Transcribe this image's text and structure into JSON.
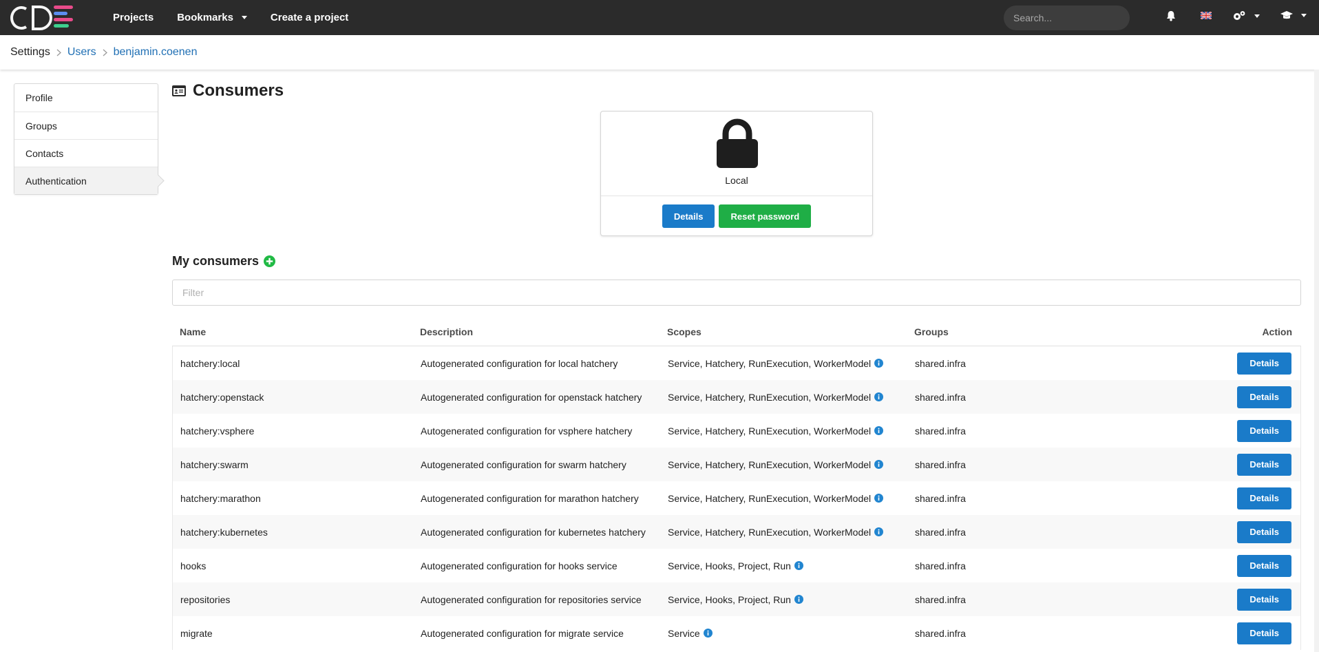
{
  "topbar": {
    "nav": [
      "Projects",
      "Bookmarks",
      "Create a project"
    ],
    "search_placeholder": "Search..."
  },
  "breadcrumb": [
    "Settings",
    "Users",
    "benjamin.coenen"
  ],
  "sidebar": {
    "items": [
      "Profile",
      "Groups",
      "Contacts",
      "Authentication"
    ],
    "active": "Authentication"
  },
  "page_title": "Consumers",
  "auth_card": {
    "label": "Local",
    "details_button": "Details",
    "reset_button": "Reset password"
  },
  "consumers": {
    "title": "My consumers",
    "filter_placeholder": "Filter",
    "columns": [
      "Name",
      "Description",
      "Scopes",
      "Groups",
      "Action"
    ],
    "rows": [
      {
        "name": "hatchery:local",
        "description": "Autogenerated configuration for local hatchery",
        "scopes": "Service, Hatchery, RunExecution, WorkerModel",
        "groups": "shared.infra",
        "action": "Details"
      },
      {
        "name": "hatchery:openstack",
        "description": "Autogenerated configuration for openstack hatchery",
        "scopes": "Service, Hatchery, RunExecution, WorkerModel",
        "groups": "shared.infra",
        "action": "Details"
      },
      {
        "name": "hatchery:vsphere",
        "description": "Autogenerated configuration for vsphere hatchery",
        "scopes": "Service, Hatchery, RunExecution, WorkerModel",
        "groups": "shared.infra",
        "action": "Details"
      },
      {
        "name": "hatchery:swarm",
        "description": "Autogenerated configuration for swarm hatchery",
        "scopes": "Service, Hatchery, RunExecution, WorkerModel",
        "groups": "shared.infra",
        "action": "Details"
      },
      {
        "name": "hatchery:marathon",
        "description": "Autogenerated configuration for marathon hatchery",
        "scopes": "Service, Hatchery, RunExecution, WorkerModel",
        "groups": "shared.infra",
        "action": "Details"
      },
      {
        "name": "hatchery:kubernetes",
        "description": "Autogenerated configuration for kubernetes hatchery",
        "scopes": "Service, Hatchery, RunExecution, WorkerModel",
        "groups": "shared.infra",
        "action": "Details"
      },
      {
        "name": "hooks",
        "description": "Autogenerated configuration for hooks service",
        "scopes": "Service, Hooks, Project, Run",
        "groups": "shared.infra",
        "action": "Details"
      },
      {
        "name": "repositories",
        "description": "Autogenerated configuration for repositories service",
        "scopes": "Service, Hooks, Project, Run",
        "groups": "shared.infra",
        "action": "Details"
      },
      {
        "name": "migrate",
        "description": "Autogenerated configuration for migrate service",
        "scopes": "Service",
        "groups": "shared.infra",
        "action": "Details"
      }
    ]
  },
  "colors": {
    "topbar": "#2b2b2b",
    "link": "#1f6fb4",
    "primary_button": "#1a7bc9",
    "success_button": "#1fae46",
    "info_icon": "#2185d0",
    "add_icon": "#21ba45"
  }
}
